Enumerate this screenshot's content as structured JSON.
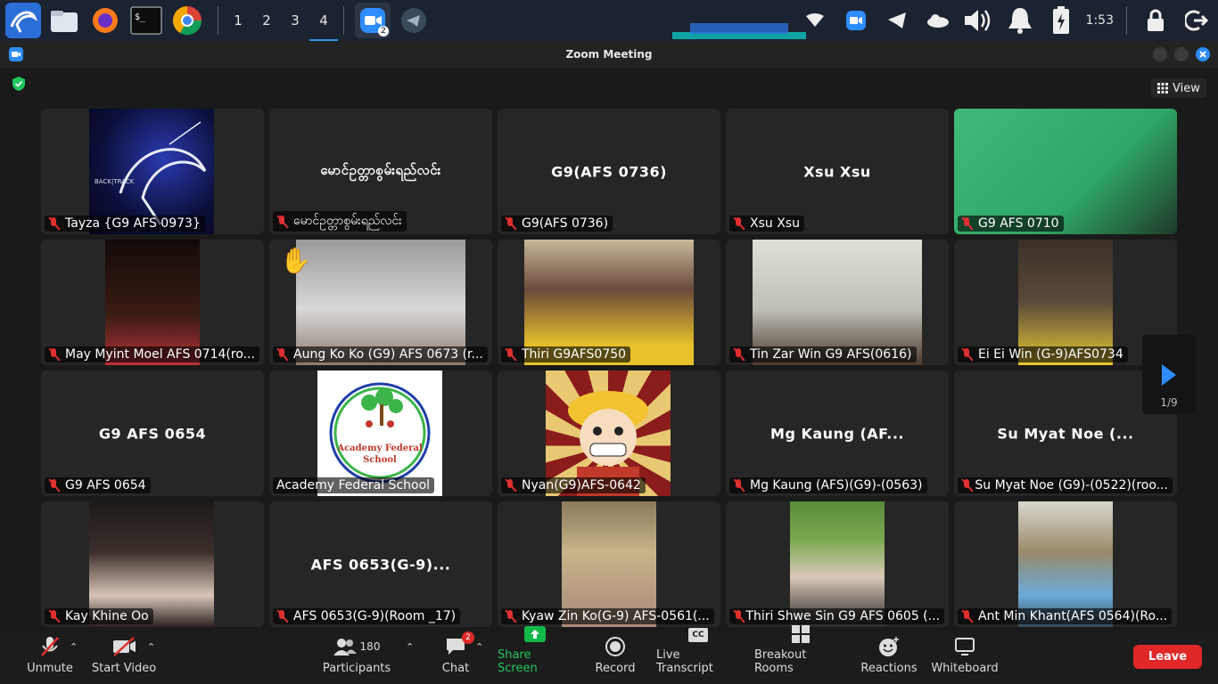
{
  "taskbar": {
    "workspaces": [
      "1",
      "2",
      "3",
      "4"
    ],
    "active_workspace": "4",
    "zoom_badge": "2",
    "clock": "1:53"
  },
  "window": {
    "title": "Zoom Meeting"
  },
  "header": {
    "view_label": "View"
  },
  "gallery": {
    "page_indicator": "1/9",
    "tiles": [
      {
        "name": "Tayza {G9 AFS 0973}",
        "center": ""
      },
      {
        "name": "မောင်ဥတ္တာစွမ်းရည်လင်း",
        "center": "မောင်ဥတ္တာစွမ်းရည်လင်း"
      },
      {
        "name": "G9(AFS 0736)",
        "center": "G9(AFS 0736)"
      },
      {
        "name": "Xsu Xsu",
        "center": "Xsu Xsu"
      },
      {
        "name": "G9 AFS 0710",
        "center": ""
      },
      {
        "name": "May Myint Moel AFS 0714(ro...",
        "center": ""
      },
      {
        "name": "Aung Ko Ko (G9) AFS 0673 (r...",
        "center": ""
      },
      {
        "name": "Thiri G9AFS0750",
        "center": ""
      },
      {
        "name": "Tin Zar Win G9 AFS(0616)",
        "center": ""
      },
      {
        "name": "Ei Ei Win (G-9)AFS0734",
        "center": ""
      },
      {
        "name": "G9 AFS 0654",
        "center": "G9 AFS 0654"
      },
      {
        "name": "Academy Federal School",
        "center": ""
      },
      {
        "name": "Nyan(G9)AFS-0642",
        "center": ""
      },
      {
        "name": "Mg Kaung (AFS)(G9)-(0563)",
        "center": "Mg Kaung (AF..."
      },
      {
        "name": "Su Myat Noe (G9)-(0522)(roo...",
        "center": "Su Myat Noe (..."
      },
      {
        "name": "Kay Khine Oo",
        "center": ""
      },
      {
        "name": "AFS 0653(G-9)(Room _17)",
        "center": "AFS 0653(G-9)..."
      },
      {
        "name": "Kyaw Zin Ko(G-9) AFS-0561(...",
        "center": ""
      },
      {
        "name": "Thiri Shwe Sin G9 AFS 0605 (...",
        "center": ""
      },
      {
        "name": "Ant Min Khant(AFS 0564)(Ro...",
        "center": ""
      }
    ]
  },
  "logo": {
    "line1": "Academy Federal",
    "line2": "School",
    "backtrack": "BACK|TRACK"
  },
  "toolbar": {
    "unmute": "Unmute",
    "start_video": "Start Video",
    "participants": "Participants",
    "participants_count": "180",
    "chat": "Chat",
    "chat_badge": "2",
    "share_screen": "Share Screen",
    "record": "Record",
    "live_transcript": "Live Transcript",
    "cc_icon_text": "CC",
    "breakout_rooms": "Breakout Rooms",
    "reactions": "Reactions",
    "whiteboard": "Whiteboard",
    "leave": "Leave"
  },
  "colors": {
    "accent": "#2d8cff",
    "leave": "#e02828",
    "share": "#12b84a",
    "mic_off": "#e02f2f"
  }
}
